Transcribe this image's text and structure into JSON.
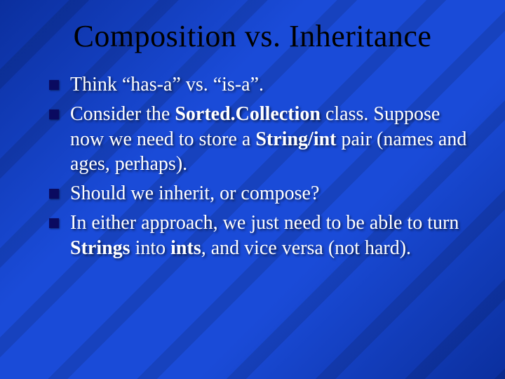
{
  "slide": {
    "title": "Composition vs. Inheritance",
    "bullets": [
      {
        "pre": "Think “has-a” vs. “is-a”."
      },
      {
        "pre": "Consider the ",
        "b1": "Sorted.Collection",
        "mid": " class. Suppose now we need to store a ",
        "b2": "String/int",
        "post": " pair (names and ages, perhaps)."
      },
      {
        "pre": "Should we inherit, or compose?"
      },
      {
        "pre": "In either approach, we just need to be able to turn ",
        "b1": "Strings",
        "mid": " into ",
        "b2": "ints",
        "post": ", and vice versa (not hard)."
      }
    ]
  }
}
